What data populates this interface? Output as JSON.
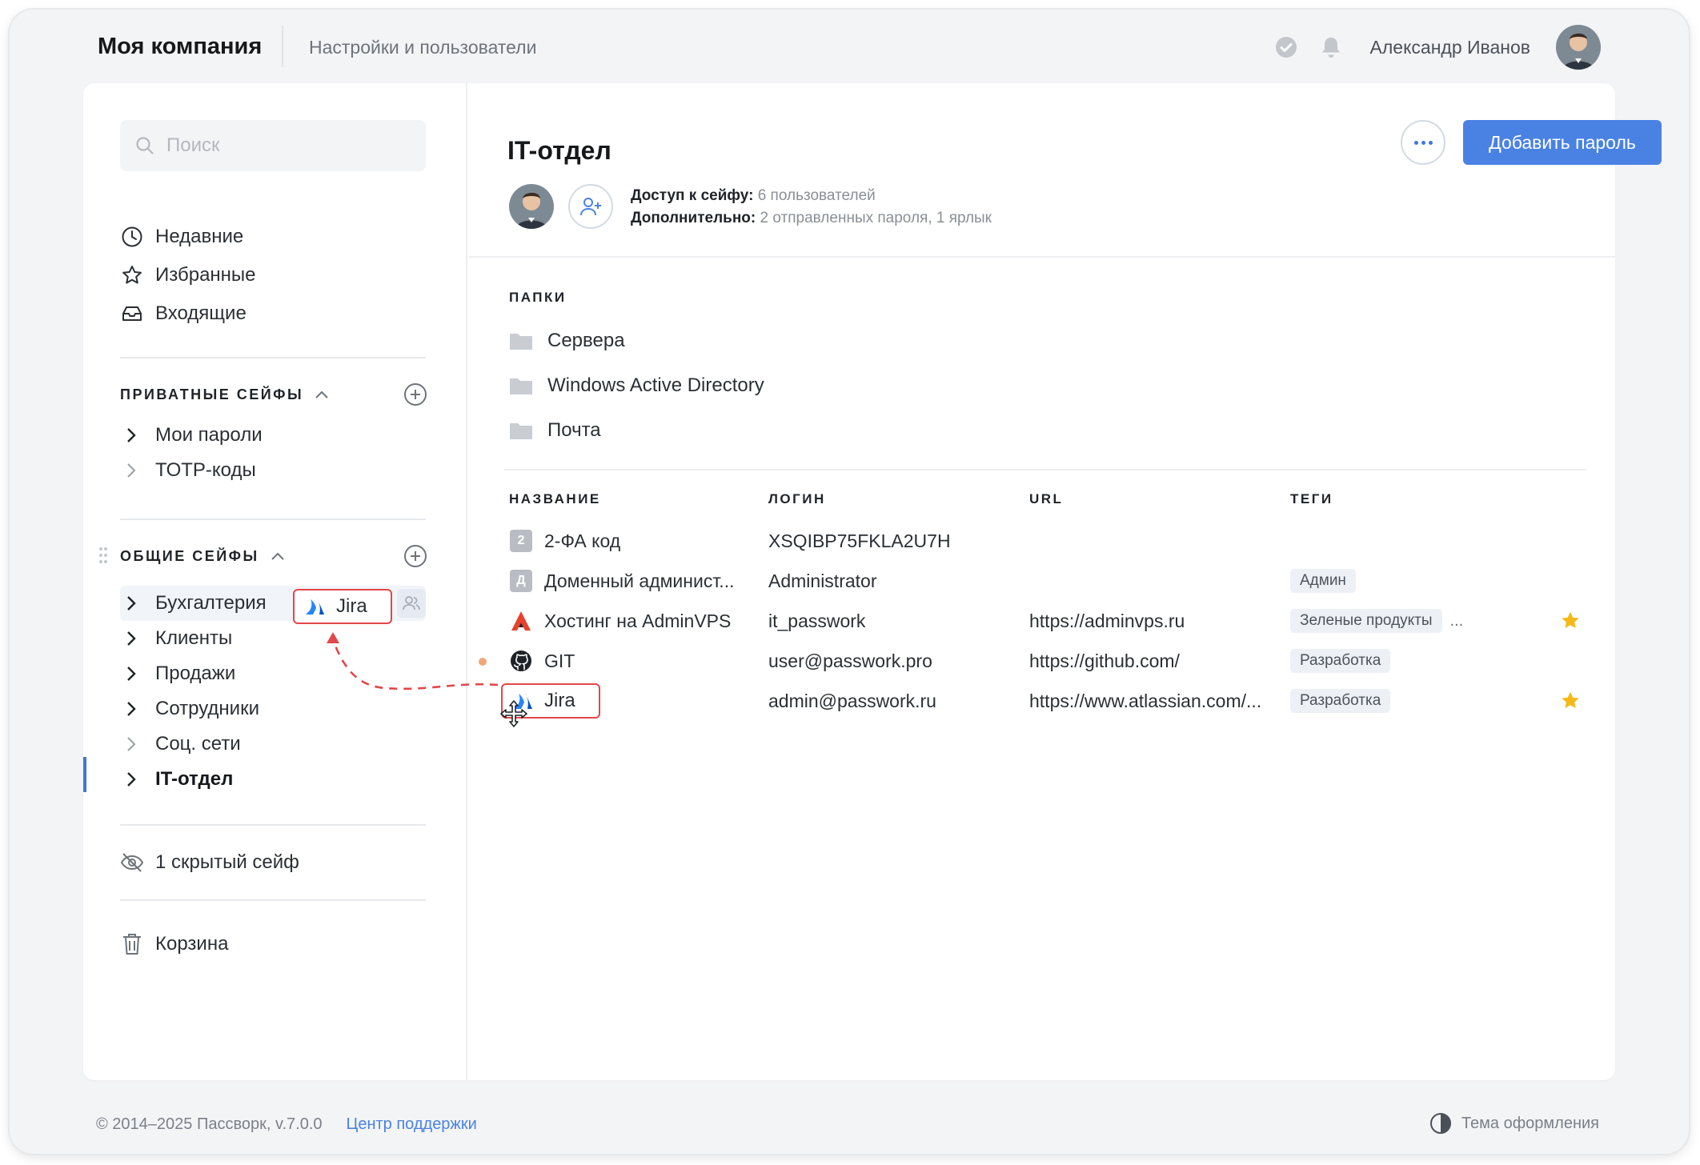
{
  "header": {
    "brand": "Моя компания",
    "breadcrumb": "Настройки и пользователи",
    "user_name": "Александр Иванов"
  },
  "sidebar": {
    "search_placeholder": "Поиск",
    "nav": [
      {
        "label": "Недавние",
        "icon": "clock-icon"
      },
      {
        "label": "Избранные",
        "icon": "star-icon"
      },
      {
        "label": "Входящие",
        "icon": "inbox-icon"
      }
    ],
    "private_section": {
      "title": "ПРИВАТНЫЕ СЕЙФЫ",
      "items": [
        {
          "label": "Мои пароли"
        },
        {
          "label": "ТОТР-коды"
        }
      ]
    },
    "shared_section": {
      "title": "ОБЩИЕ СЕЙФЫ",
      "items": [
        {
          "label": "Бухгалтерия"
        },
        {
          "label": "Клиенты"
        },
        {
          "label": "Продажи"
        },
        {
          "label": "Сотрудники"
        },
        {
          "label": "Соц. сети"
        },
        {
          "label": "IT-отдел",
          "active": true
        }
      ]
    },
    "hidden_vaults": "1 скрытый сейф",
    "trash": "Корзина",
    "drag_ghost_label": "Jira"
  },
  "vault": {
    "title": "IT-отдел",
    "add_button": "Добавить пароль",
    "access_key": "Доступ к сейфу:",
    "access_value": "6 пользователей",
    "extra_key": "Дополнительно:",
    "extra_value": "2 отправленных пароля, 1 ярлык"
  },
  "folders": {
    "title": "ПАПКИ",
    "items": [
      {
        "label": "Сервера"
      },
      {
        "label": "Windows Active Directory"
      },
      {
        "label": "Почта"
      }
    ]
  },
  "table": {
    "columns": {
      "name": "НАЗВАНИЕ",
      "login": "ЛОГИН",
      "url": "URL",
      "tags": "ТЕГИ"
    },
    "rows": [
      {
        "name": "2-ФА код",
        "icon_letter": "2",
        "login": "XSQIBP75FKLA2U7H",
        "url": "",
        "tags": [],
        "starred": false
      },
      {
        "name": "Доменный админист...",
        "icon_letter": "Д",
        "login": "Administrator",
        "url": "",
        "tags": [
          "Админ"
        ],
        "starred": false
      },
      {
        "name": "Хостинг на AdminVPS",
        "icon": "adminvps-icon",
        "login": "it_passwork",
        "url": "https://adminvps.ru",
        "tags": [
          "Зеленые продукты"
        ],
        "tags_more": "...",
        "starred": true
      },
      {
        "name": "GIT",
        "icon": "github-icon",
        "login": "user@passwork.pro",
        "url": "https://github.com/",
        "tags": [
          "Разработка"
        ],
        "starred": false
      },
      {
        "name": "Jira",
        "icon": "jira-icon",
        "login": "admin@passwork.ru",
        "url": "https://www.atlassian.com/...",
        "tags": [
          "Разработка"
        ],
        "starred": true
      }
    ]
  },
  "footer": {
    "copyright": "© 2014–2025 Пассворк, v.7.0.0",
    "support": "Центр поддержки",
    "theme": "Тема оформления"
  },
  "colors": {
    "accent": "#4a82e4",
    "drag_highlight": "#e2474a",
    "star": "#f5b918"
  }
}
